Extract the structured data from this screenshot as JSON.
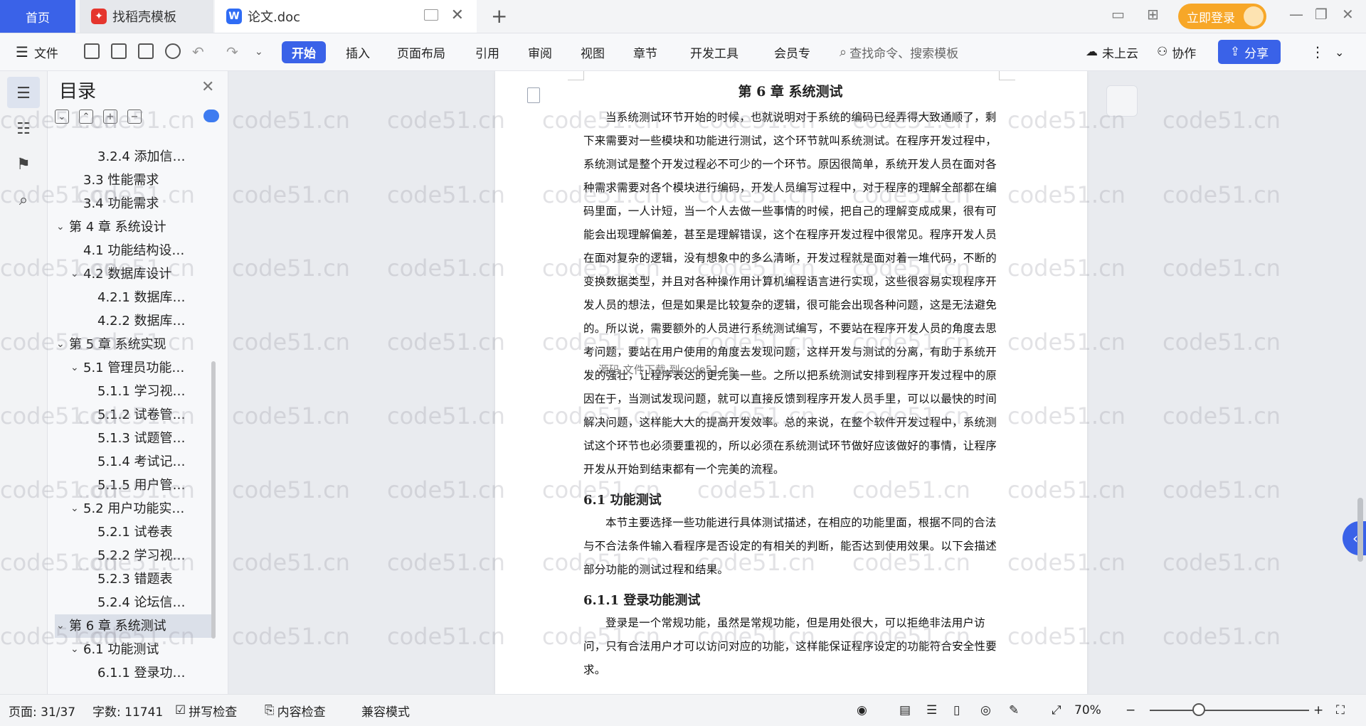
{
  "tabs": {
    "home": "首页",
    "docer": "找稻壳模板",
    "doc": "论文.doc",
    "login": "立即登录"
  },
  "menubar": {
    "file": "文件",
    "items": [
      "开始",
      "插入",
      "页面布局",
      "引用",
      "审阅",
      "视图",
      "章节",
      "开发工具",
      "会员专"
    ],
    "search_placeholder": "查找命令、搜索模板",
    "cloud": "未上云",
    "collab": "协作",
    "share": "分享"
  },
  "toc": {
    "title": "目录",
    "items": [
      {
        "label": "3.2.4 添加信…",
        "level": 3
      },
      {
        "label": "3.3 性能需求",
        "level": 2
      },
      {
        "label": "3.4 功能需求",
        "level": 2
      },
      {
        "label": "第 4 章 系统设计",
        "level": 1,
        "expandable": true
      },
      {
        "label": "4.1 功能结构设…",
        "level": 2
      },
      {
        "label": "4.2 数据库设计",
        "level": 2,
        "expandable": true
      },
      {
        "label": "4.2.1 数据库…",
        "level": 3
      },
      {
        "label": "4.2.2 数据库…",
        "level": 3
      },
      {
        "label": "第 5 章 系统实现",
        "level": 1,
        "expandable": true
      },
      {
        "label": "5.1 管理员功能…",
        "level": 2,
        "expandable": true
      },
      {
        "label": "5.1.1 学习视…",
        "level": 3
      },
      {
        "label": "5.1.2 试卷管…",
        "level": 3
      },
      {
        "label": "5.1.3 试题管…",
        "level": 3
      },
      {
        "label": "5.1.4 考试记…",
        "level": 3
      },
      {
        "label": "5.1.5 用户管…",
        "level": 3
      },
      {
        "label": "5.2 用户功能实…",
        "level": 2,
        "expandable": true
      },
      {
        "label": "5.2.1 试卷表",
        "level": 3
      },
      {
        "label": "5.2.2 学习视…",
        "level": 3
      },
      {
        "label": "5.2.3 错题表",
        "level": 3
      },
      {
        "label": "5.2.4 论坛信…",
        "level": 3
      },
      {
        "label": "第 6 章 系统测试",
        "level": 1,
        "expandable": true,
        "active": true
      },
      {
        "label": "6.1 功能测试",
        "level": 2,
        "expandable": true
      },
      {
        "label": "6.1.1 登录功…",
        "level": 3
      }
    ]
  },
  "doc": {
    "chapter": "第 6 章 系统测试",
    "para1": "当系统测试环节开始的时候，也就说明对于系统的编码已经弄得大致通顺了，剩下来需要对一些模块和功能进行测试，这个环节就叫系统测试。在程序开发过程中，系统测试是整个开发过程必不可少的一个环节。原因很简单，系统开发人员在面对各种需求需要对各个模块进行编码，开发人员编写过程中，对于程序的理解全部都在编码里面，一人计短，当一个人去做一些事情的时候，把自己的理解变成成果，很有可能会出现理解偏差，甚至是理解错误，这个在程序开发过程中很常见。程序开发人员在面对复杂的逻辑，没有想象中的多么清晰，开发过程就是面对着一堆代码，不断的变换数据类型，并且对各种操作用计算机编程语言进行实现，这些很容易实现程序开发人员的想法，但是如果是比较复杂的逻辑，很可能会出现各种问题，这是无法避免的。所以说，需要额外的人员进行系统测试编写，不要站在程序开发人员的角度去思考问题，要站在用户使用的角度去发现问题，这样开发与测试的分离，有助于系统开发的强壮，让程序表达的更完美一些。之所以把系统测试安排到程序开发过程中的原因在于，当测试发现问题，就可以直接反馈到程序开发人员手里，可以以最快的时间解决问题，这样能大大的提高开发效率。总的来说，在整个软件开发过程中，系统测试这个环节也必须要重视的，所以必须在系统测试环节做好应该做好的事情，让程序开发从开始到结束都有一个完美的流程。",
    "overlay": "源码 文件下载 到code51.cn",
    "sec1": "6.1  功能测试",
    "para2": "本节主要选择一些功能进行具体测试描述，在相应的功能里面，根据不同的合法与不合法条件输入看程序是否设定的有相关的判断，能否达到使用效果。以下会描述部分功能的测试过程和结果。",
    "sec2": "6.1.1  登录功能测试",
    "para3": "登录是一个常规功能，虽然是常规功能，但是用处很大，可以拒绝非法用户访问，只有合法用户才可以访问对应的功能，这样能保证程序设定的功能符合安全性要求。"
  },
  "watermark": "code51.cn",
  "status": {
    "page": "页面: 31/37",
    "words": "字数: 11741",
    "spell": "拼写检查",
    "content": "内容检查",
    "compat": "兼容模式",
    "zoom": "70%"
  }
}
